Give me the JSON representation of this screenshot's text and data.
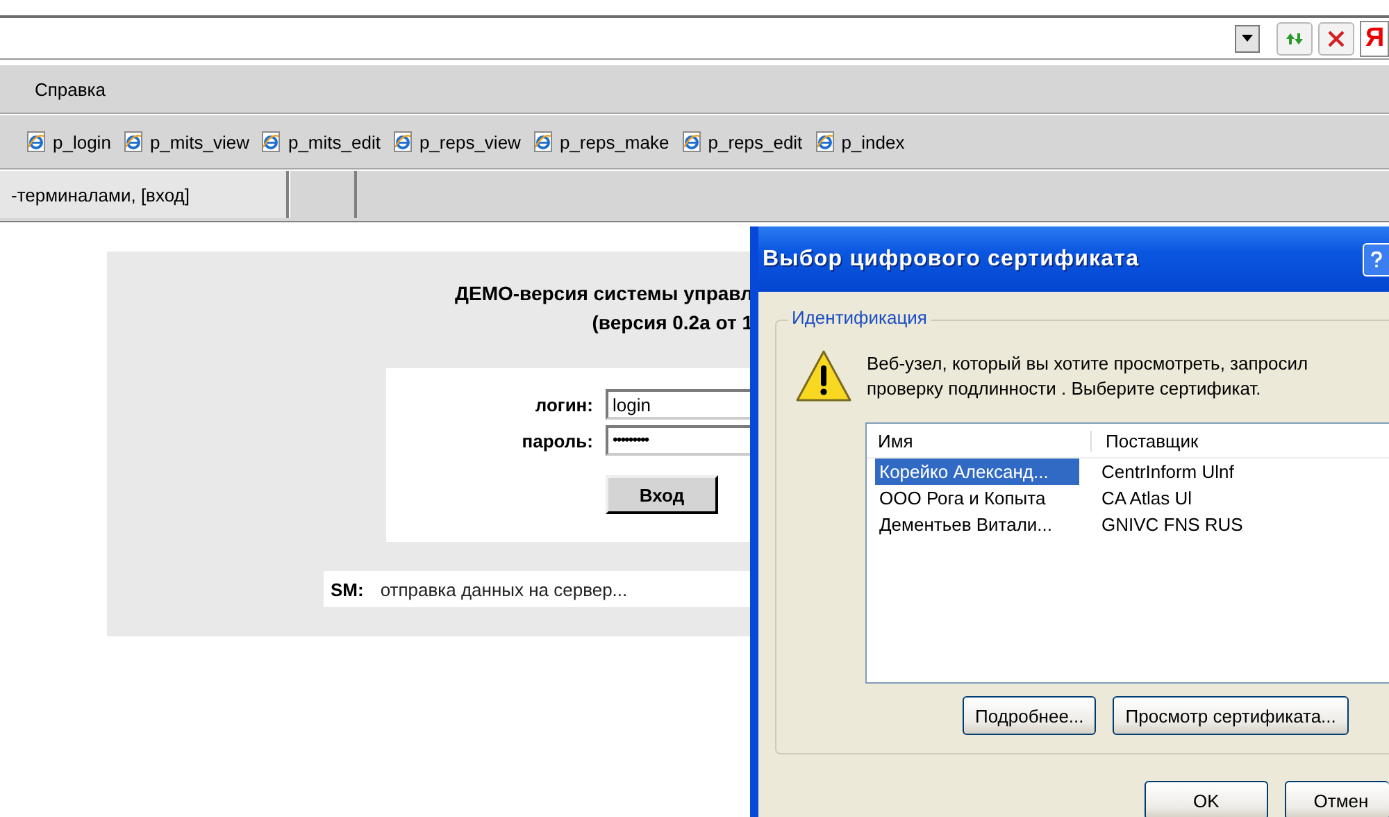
{
  "address_bar": {
    "logo_letter": "Я"
  },
  "menu": [
    {
      "label": "Справка"
    }
  ],
  "links": [
    {
      "label": "p_login"
    },
    {
      "label": "p_mits_view"
    },
    {
      "label": "p_mits_edit"
    },
    {
      "label": "p_reps_view"
    },
    {
      "label": "p_reps_make"
    },
    {
      "label": "p_reps_edit"
    },
    {
      "label": "p_index"
    }
  ],
  "tabs": [
    {
      "label": "-терминалами, [вход]"
    },
    {
      "kind": "blank"
    }
  ],
  "page": {
    "title_lines": [
      "ДЕМО-версия системы управл",
      "(версия 0.2а от 1"
    ],
    "fields": [
      {
        "label": "логин:",
        "value": "login",
        "kind": "text"
      },
      {
        "label": "пароль:",
        "value": "•••••••••",
        "kind": "password"
      }
    ],
    "submit": "Вход",
    "status": {
      "label": "SM:",
      "text": "отправка данных на сервер..."
    }
  },
  "dialog": {
    "title": "Выбор цифрового сертификата",
    "group": "Идентификация",
    "message": "Веб-узел, который вы хотите просмотреть, запросил проверку подлинности . Выберите сертификат.",
    "columns": [
      "Имя",
      "Поставщик"
    ],
    "rows": [
      {
        "name": "Корейко Александ...",
        "issuer": "CentrInform Ulnf",
        "selected": true
      },
      {
        "name": "ООО Рога и Копыта",
        "issuer": "CA Atlas Ul",
        "selected": false
      },
      {
        "name": "Дементьев Витали...",
        "issuer": "GNIVC FNS RUS",
        "selected": false
      }
    ],
    "list_buttons": [
      "Подробнее...",
      "Просмотр сертификата..."
    ],
    "footer_buttons": [
      "OK",
      "Отмен"
    ]
  }
}
